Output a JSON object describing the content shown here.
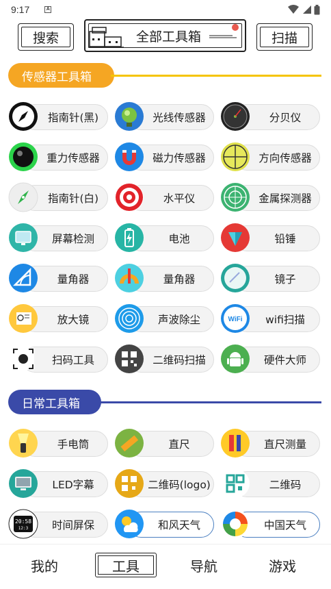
{
  "status_bar": {
    "time": "9:17",
    "notification_icon": "a-letter-icon"
  },
  "top_bar": {
    "search_label": "搜索",
    "title": "全部工具箱",
    "scan_label": "扫描"
  },
  "colors": {
    "sensor_accent": "#f5a623",
    "daily_accent": "#3a4aa8"
  },
  "sections": {
    "sensor": {
      "title": "传感器工具箱",
      "tools": [
        {
          "label": "指南针(黑)",
          "icon": "compass-black-icon"
        },
        {
          "label": "光线传感器",
          "icon": "light-bulb-icon"
        },
        {
          "label": "分贝仪",
          "icon": "decibel-meter-icon"
        },
        {
          "label": "重力传感器",
          "icon": "gravity-ball-icon"
        },
        {
          "label": "磁力传感器",
          "icon": "magnet-icon"
        },
        {
          "label": "方向传感器",
          "icon": "direction-crosshair-icon"
        },
        {
          "label": "指南针(白)",
          "icon": "compass-white-icon"
        },
        {
          "label": "水平仪",
          "icon": "level-target-icon"
        },
        {
          "label": "金属探测器",
          "icon": "radar-icon"
        },
        {
          "label": "屏幕检测",
          "icon": "screen-test-icon"
        },
        {
          "label": "电池",
          "icon": "battery-icon"
        },
        {
          "label": "铅锤",
          "icon": "plumb-bob-icon"
        },
        {
          "label": "量角器",
          "icon": "protractor-blue-icon"
        },
        {
          "label": "量角器",
          "icon": "protractor-orange-icon"
        },
        {
          "label": "镜子",
          "icon": "mirror-icon"
        },
        {
          "label": "放大镜",
          "icon": "magnifier-icon"
        },
        {
          "label": "声波除尘",
          "icon": "sound-wave-icon"
        },
        {
          "label": "wifi扫描",
          "icon": "wifi-scan-icon"
        },
        {
          "label": "扫码工具",
          "icon": "scan-code-icon"
        },
        {
          "label": "二维码扫描",
          "icon": "qr-scan-icon"
        },
        {
          "label": "硬件大师",
          "icon": "android-icon"
        }
      ]
    },
    "daily": {
      "title": "日常工具箱",
      "tools": [
        {
          "label": "手电筒",
          "icon": "flashlight-icon"
        },
        {
          "label": "直尺",
          "icon": "ruler-icon"
        },
        {
          "label": "直尺测量",
          "icon": "ruler-pencil-icon"
        },
        {
          "label": "LED字幕",
          "icon": "led-monitor-icon"
        },
        {
          "label": "二维码(logo)",
          "icon": "qr-logo-icon"
        },
        {
          "label": "二维码",
          "icon": "qr-code-icon"
        },
        {
          "label": "时间屏保",
          "icon": "digital-clock-icon"
        },
        {
          "label": "和风天气",
          "icon": "weather-icon"
        },
        {
          "label": "中国天气",
          "icon": "china-weather-icon"
        }
      ]
    }
  },
  "bottom_nav": {
    "items": [
      "我的",
      "工具",
      "导航",
      "游戏"
    ],
    "active": "工具"
  }
}
